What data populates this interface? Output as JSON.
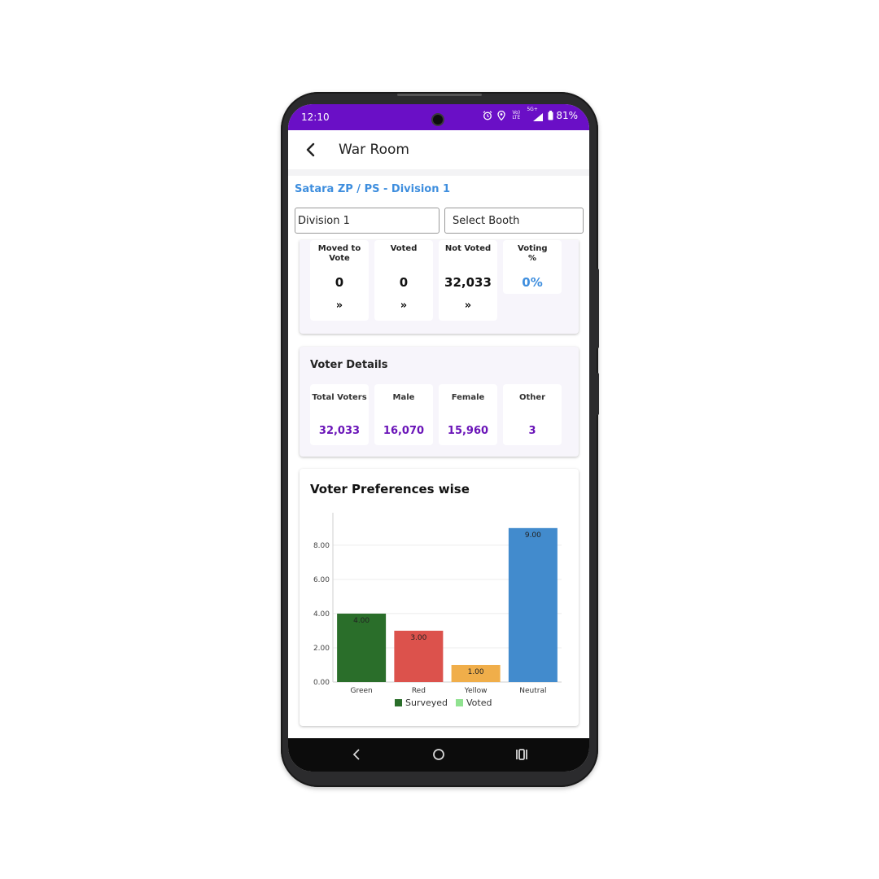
{
  "status_bar": {
    "time": "12:10",
    "network": "Vo) LTE",
    "signal": "5G+",
    "battery": "81%",
    "icons": [
      "alarm-icon",
      "location-icon",
      "signal-icon",
      "battery-icon"
    ]
  },
  "app_bar": {
    "title": "War Room"
  },
  "breadcrumb": "Satara ZP / PS - Division 1",
  "filters": {
    "division": "Division 1",
    "booth": "Select Booth"
  },
  "voting_stats": [
    {
      "label": "Moved to Vote",
      "value": "0",
      "link": "»"
    },
    {
      "label": "Voted",
      "value": "0",
      "link": "»"
    },
    {
      "label": "Not Voted",
      "value": "32,033",
      "link": "»"
    },
    {
      "label": "Voting %",
      "value": "0%"
    }
  ],
  "voter_details": {
    "title": "Voter Details",
    "items": [
      {
        "label": "Total Voters",
        "value": "32,033"
      },
      {
        "label": "Male",
        "value": "16,070"
      },
      {
        "label": "Female",
        "value": "15,960"
      },
      {
        "label": "Other",
        "value": "3"
      }
    ]
  },
  "colors": {
    "accent": "#6a0fc6",
    "link_blue": "#3e8ede",
    "value_purple": "#6a14b8"
  },
  "chart_data": {
    "type": "bar",
    "title": "Voter Preferences wise",
    "categories": [
      "Green",
      "Red",
      "Yellow",
      "Neutral"
    ],
    "series": [
      {
        "name": "Surveyed",
        "values": [
          4,
          3,
          1,
          9
        ],
        "colors": [
          "#2a6e2a",
          "#dc524c",
          "#f0ae4a",
          "#428bcd"
        ],
        "legend_color": "#2a6e2a"
      },
      {
        "name": "Voted",
        "values": [
          0,
          0,
          0,
          0
        ],
        "legend_color": "#90e290"
      }
    ],
    "data_labels": [
      "4.00",
      "3.00",
      "1.00",
      "9.00"
    ],
    "yticks": [
      "0.00",
      "2.00",
      "4.00",
      "6.00",
      "8.00"
    ],
    "ylim": [
      0,
      9.8
    ],
    "grid": true,
    "legend": "bottom"
  }
}
